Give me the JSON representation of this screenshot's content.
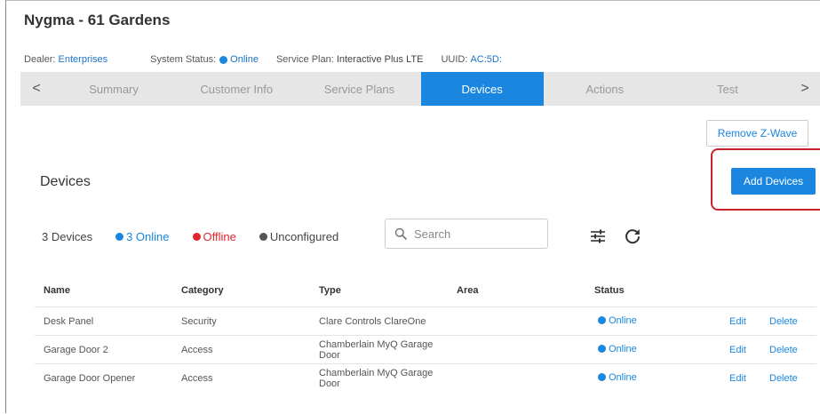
{
  "page": {
    "title": "Nygma - 61 Gardens"
  },
  "info": {
    "dealer_label": "Dealer:",
    "dealer_value": "Enterprises",
    "status_label": "System Status:",
    "status_value": "Online",
    "plan_label": "Service Plan:",
    "plan_value": "Interactive Plus LTE",
    "uuid_label": "UUID:",
    "uuid_value": "AC:5D:"
  },
  "tabs": {
    "prev_glyph": "<",
    "next_glyph": ">",
    "items": [
      {
        "label": "Summary"
      },
      {
        "label": "Customer Info"
      },
      {
        "label": "Service Plans"
      },
      {
        "label": "Devices"
      },
      {
        "label": "Actions"
      },
      {
        "label": "Test"
      }
    ],
    "active": "Devices"
  },
  "devices": {
    "remove_zwave_label": "Remove Z-Wave",
    "section_title": "Devices",
    "add_devices_label": "Add Devices",
    "filters": {
      "count": "3 Devices",
      "online": "3 Online",
      "offline": "Offline",
      "unconfigured": "Unconfigured"
    },
    "search_placeholder": "Search",
    "columns": [
      "Name",
      "Category",
      "Type",
      "Area",
      "Status"
    ],
    "rows": [
      {
        "name": "Desk Panel",
        "category": "Security",
        "type": "Clare Controls ClareOne",
        "area": "",
        "status": "Online",
        "edit": "Edit",
        "delete": "Delete"
      },
      {
        "name": "Garage Door 2",
        "category": "Access",
        "type": "Chamberlain MyQ Garage Door",
        "area": "",
        "status": "Online",
        "edit": "Edit",
        "delete": "Delete"
      },
      {
        "name": "Garage Door Opener",
        "category": "Access",
        "type": "Chamberlain MyQ Garage Door",
        "area": "",
        "status": "Online",
        "edit": "Edit",
        "delete": "Delete"
      }
    ]
  },
  "colors": {
    "accent": "#1a86e0",
    "offline": "#e0262b",
    "highlight": "#c8232a",
    "tabbar": "#e6e6e6"
  },
  "icons": {
    "search": "search-icon",
    "filter": "sliders-icon",
    "refresh": "refresh-icon"
  }
}
